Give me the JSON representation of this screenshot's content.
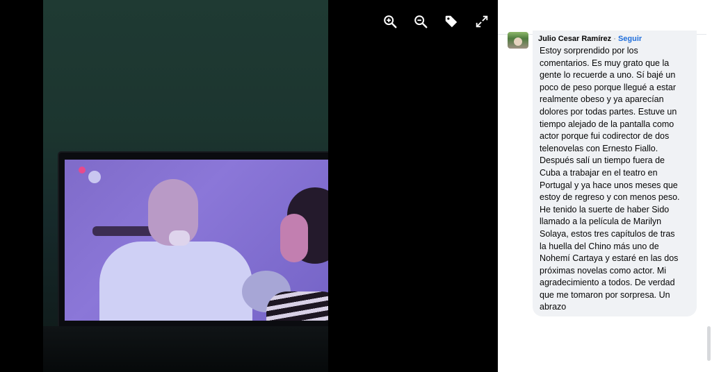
{
  "toolbar": {
    "icons": [
      "zoom-in-icon",
      "zoom-out-icon",
      "tag-icon",
      "fullscreen-icon"
    ]
  },
  "comment": {
    "author": "Julio Cesar Ramírez",
    "separator": "·",
    "follow_label": "Seguir",
    "text": "Estoy sorprendido por los\ncomentarios. Es muy grato que la\ngente lo recuerde a uno. Sí bajé un\npoco de peso porque llegué a estar\nrealmente obeso y ya aparecían\ndolores por todas partes. Estuve un\ntiempo alejado de la pantalla como\nactor porque fui codirector de dos\ntelenovelas con Ernesto Fiallo.\nDespués salí un tiempo fuera de\nCuba a trabajar en el teatro en\nPortugal y ya hace unos meses que\nestoy de regreso y con menos peso.\nHe tenido la suerte de haber Sido\nllamado a la película de Marilyn\nSolaya, estos tres capítulos de tras\nla huella del Chino más uno de\nNohemí Cartaya y estaré en las dos\npróximas novelas como actor. Mi\nagradecimiento a todos. De verdad\nque me tomaron por sorpresa. Un\nabrazo"
  },
  "colors": {
    "viewer_bg": "#000000",
    "panel_bg": "#ffffff",
    "bubble_bg": "#f0f2f5",
    "follow_link": "#216fdb",
    "tv_screen": "#8b77d8"
  }
}
